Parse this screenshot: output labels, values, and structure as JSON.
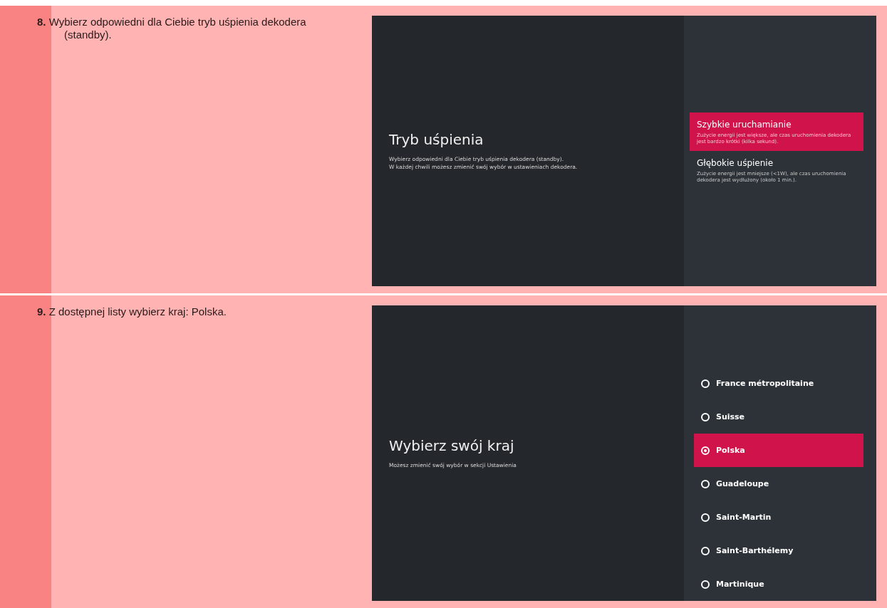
{
  "steps": [
    {
      "number": "8.",
      "text": "Wybierz odpowiedni dla Ciebie tryb uśpienia dekodera (standby).",
      "screen": {
        "kind": "options",
        "title": "Tryb uśpienia",
        "description": [
          "Wybierz odpowiedni dla Ciebie tryb uśpienia dekodera (standby).",
          "W każdej chwili możesz zmienić swój wybór w ustawieniach dekodera."
        ],
        "options": [
          {
            "label": "Szybkie uruchamianie",
            "detail": "Zużycie energii jest większe, ale czas uruchomienia dekodera jest bardzo krótki (kilka sekund).",
            "selected": true
          },
          {
            "label": "Głębokie uśpienie",
            "detail": "Zużycie energii jest mniejsze (<1W), ale czas uruchomienia dekodera jest wydłużony (około 1 min.).",
            "selected": false
          }
        ]
      }
    },
    {
      "number": "9.",
      "text": "Z dostępnej listy wybierz kraj: Polska.",
      "screen": {
        "kind": "radio",
        "title": "Wybierz swój kraj",
        "description": [
          "Możesz zmienić swój wybór w sekcji Ustawienia"
        ],
        "options": [
          {
            "label": "France métropolitaine",
            "selected": false
          },
          {
            "label": "Suisse",
            "selected": false
          },
          {
            "label": "Polska",
            "selected": true
          },
          {
            "label": "Guadeloupe",
            "selected": false
          },
          {
            "label": "Saint-Martin",
            "selected": false
          },
          {
            "label": "Saint-Barthélemy",
            "selected": false
          },
          {
            "label": "Martinique",
            "selected": false
          }
        ]
      }
    }
  ]
}
